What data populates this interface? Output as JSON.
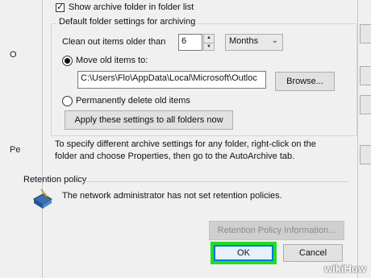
{
  "background": {
    "letters": [
      "O",
      "Pe"
    ]
  },
  "archive": {
    "show_in_folder_list_label": "Show archive folder in folder list",
    "show_in_folder_list_checked": true,
    "group_label": "Default folder settings for archiving",
    "clean_out_label": "Clean out items older than",
    "clean_out_value": "6",
    "unit_value": "Months",
    "move_label": "Move old items to:",
    "move_selected": true,
    "path_value": "C:\\Users\\Flo\\AppData\\Local\\Microsoft\\Outloc",
    "browse_label": "Browse...",
    "delete_label": "Permanently delete old items",
    "delete_selected": false,
    "apply_all_label": "Apply these settings to all folders now",
    "info_text": "To specify different archive settings for any folder, right-click on the folder and choose Properties, then go to the AutoArchive tab."
  },
  "retention": {
    "label": "Retention policy",
    "message": "The network administrator has not set retention policies.",
    "info_button_label": "Retention Policy Information..."
  },
  "footer": {
    "ok_label": "OK",
    "cancel_label": "Cancel"
  },
  "watermark": {
    "wiki": "wiki",
    "how": "How"
  },
  "colors": {
    "highlight": "#22dd22",
    "dialog_bg": "#f0f0f0",
    "ok_border": "#0078d7"
  }
}
